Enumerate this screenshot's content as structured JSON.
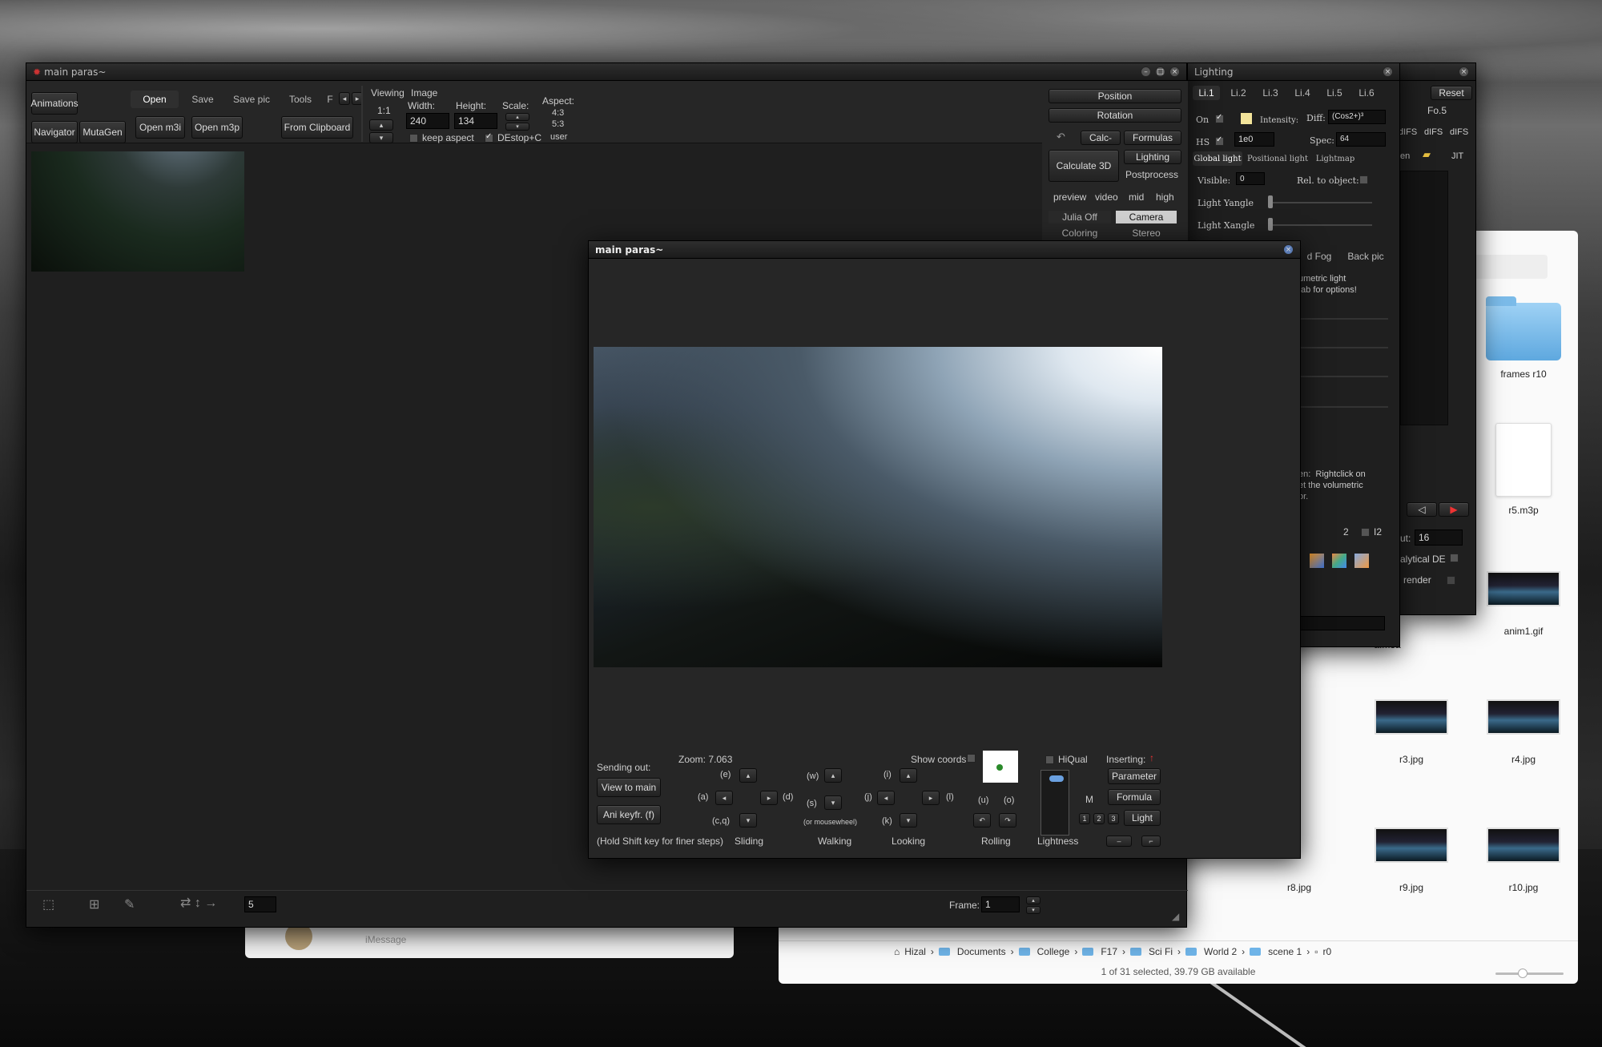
{
  "main_window": {
    "title": "main paras~",
    "left_buttons": [
      "Animations",
      "Navigator",
      "MutaGen"
    ],
    "tabs": [
      "Open",
      "Save",
      "Save pic",
      "Tools",
      "F"
    ],
    "open_m3i": "Open m3i",
    "open_m3p": "Open m3p",
    "from_clipboard": "From Clipboard",
    "viewing_label": "Viewing",
    "viewing_value": "1:1",
    "image_label": "Image",
    "width_label": "Width:",
    "width_value": "240",
    "height_label": "Height:",
    "height_value": "134",
    "scale_label": "Scale:",
    "aspect_label": "Aspect:",
    "aspect_options": [
      "4:3",
      "5:3",
      "user"
    ],
    "keep_aspect": "keep aspect",
    "destop": "DEstop+C",
    "right_buttons": {
      "position": "Position",
      "rotation": "Rotation",
      "calc": "Calc-",
      "formulas": "Formulas",
      "calculate_3d": "Calculate 3D",
      "lighting": "Lighting",
      "postprocess": "Postprocess",
      "quality": [
        "preview",
        "video",
        "mid",
        "high"
      ],
      "julia_off": "Julia Off",
      "camera": "Camera",
      "coloring": "Coloring",
      "stereo": "Stereo"
    },
    "frame_label": "Frame:",
    "frame_value": "1",
    "step_value": "5"
  },
  "lighting_window": {
    "title": "Lighting",
    "tabs": [
      "Li.1",
      "Li.2",
      "Li.3",
      "Li.4",
      "Li.5",
      "Li.6"
    ],
    "on_label": "On",
    "intensity_label": "Intensity:",
    "diff_label": "Diff:",
    "diff_value": "(Cos2+)³",
    "hs_label": "HS",
    "hs_value": "1e0",
    "spec_label": "Spec:",
    "spec_value": "64",
    "subtabs": [
      "Global light",
      "Positional light",
      "Lightmap"
    ],
    "visible_label": "Visible:",
    "visible_value": "0",
    "rel_label": "Rel. to object:",
    "yangle": "Light Yangle",
    "xangle": "Light Xangle",
    "fog_tab": "d Fog",
    "backpic_tab": "Back pic",
    "volumetric_text": "umetric light\ntab for options!",
    "rightclick_text": "en:  Rightclick on\net the volumetric\nor.",
    "num_2": "2",
    "num_12": "I2"
  },
  "back_panel": {
    "reset": "Reset",
    "fo5": "Fo.5",
    "difs": [
      "dIFS",
      "dIFS",
      "dIFS"
    ],
    "en": "en",
    "jit": "JIT",
    "ut_label": "ut:",
    "ut_value": "16",
    "analytical": "alytical DE",
    "render": "render"
  },
  "navigator_window": {
    "title": "main paras~",
    "sending_out": "Sending out:",
    "view_to_main": "View to main",
    "ani_keyfr": "Ani keyfr. (f)",
    "zoom": "Zoom: 7.063",
    "show_coords": "Show coords",
    "hiqual": "HiQual",
    "inserting": "Inserting:",
    "parameter": "Parameter",
    "formula": "Formula",
    "light": "Light",
    "m_label": "M",
    "hint": "(Hold Shift key for finer steps)",
    "key_e": "(e)",
    "key_a": "(a)",
    "key_d": "(d)",
    "key_cq": "(c,q)",
    "key_w": "(w)",
    "key_s": "(s)",
    "mousewheel": "(or mousewheel)",
    "key_i": "(i)",
    "key_j": "(j)",
    "key_l": "(l)",
    "key_k": "(k)",
    "key_u": "(u)",
    "key_o": "(o)",
    "groups": [
      "Sliding",
      "Walking",
      "Looking",
      "Rolling",
      "Lightness"
    ]
  },
  "finder": {
    "items": [
      {
        "name": "frames r10",
        "kind": "folder"
      },
      {
        "name": "r5.m3p",
        "kind": "doc"
      },
      {
        "name": "a.m3a",
        "kind": "partial"
      },
      {
        "name": "anim1.gif",
        "kind": "image"
      },
      {
        "name": "r3.jpg",
        "kind": "image"
      },
      {
        "name": "r4.jpg",
        "kind": "image"
      },
      {
        "name": "r8.jpg",
        "kind": "image"
      },
      {
        "name": "r9.jpg",
        "kind": "image"
      },
      {
        "name": "r10.jpg",
        "kind": "image"
      }
    ],
    "path": [
      "Hizal",
      "Documents",
      "College",
      "F17",
      "Sci Fi",
      "World 2",
      "scene 1",
      "r0"
    ],
    "status": "1 of 31 selected, 39.79 GB available"
  },
  "messages_window": {
    "placeholder": "iMessage"
  }
}
